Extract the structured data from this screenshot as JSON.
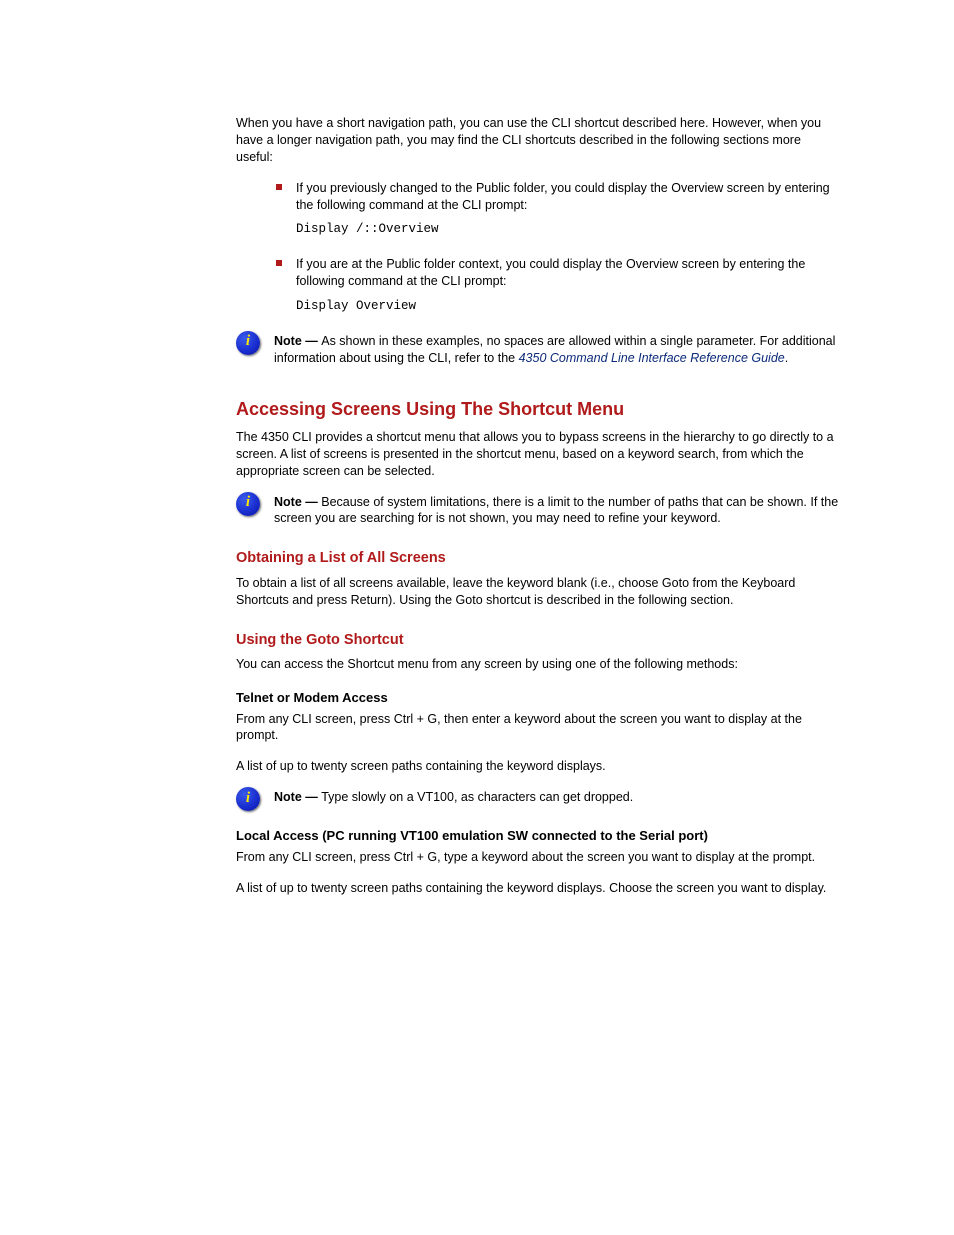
{
  "intro": "When you have a short navigation path, you can use the CLI shortcut described here. However, when you have a longer navigation path, you may find the CLI shortcuts described in the following sections more useful:",
  "bullets": [
    {
      "text": "If you previously changed to the Public folder, you could display the Overview screen by entering the following command at the CLI prompt:",
      "code": "Display /::Overview"
    },
    {
      "text": "If you are at the Public folder context, you could display the Overview screen by entering the following command at the CLI prompt:",
      "code": "Display Overview"
    }
  ],
  "note1": {
    "prefix": "Note   —   ",
    "body": "As shown in these examples, no spaces are allowed within a single parameter. For additional information about using the CLI, refer to the ",
    "ref": "4350 Command Line Interface Reference Guide",
    "suffix": "."
  },
  "h2": "Accessing Screens Using The Shortcut Menu",
  "p_after_h2": "The 4350 CLI provides a shortcut menu that allows you to bypass screens in the hierarchy to go directly to a screen. A list of screens is presented in the shortcut menu, based on a keyword search, from which the appropriate screen can be selected.",
  "note2": {
    "prefix": "Note   —   ",
    "body": "Because of system limitations, there is a limit to the number of paths that can be shown. If the screen you are searching for is not shown, you may need to refine your keyword."
  },
  "h3_1": "Obtaining a List of All Screens",
  "p_list_all": "To obtain a list of all screens available, leave the keyword blank (i.e., choose Goto from the Keyboard Shortcuts and press Return). Using the Goto shortcut is described in the following section.",
  "h3_2": "Using the Goto Shortcut",
  "p_goto_intro": "You can access the Shortcut menu from any screen by using one of the following methods:",
  "h4_1": "Telnet or Modem Access",
  "p_telnet_1": "From any CLI screen, press Ctrl + G, then enter a keyword about the screen you want to display at the prompt.",
  "p_telnet_2": "A list of up to twenty screen paths containing the keyword displays.",
  "note3": {
    "prefix": "Note   —   ",
    "body": "Type slowly on a VT100, as characters can get dropped."
  },
  "h4_2": "Local Access (PC running VT100 emulation SW connected to the Serial port)",
  "p_local_1": "From any CLI screen, press Ctrl + G, type a keyword about the screen you want to display at the prompt.",
  "p_local_2": "A list of up to twenty screen paths containing the keyword displays. Choose the screen you want to display."
}
